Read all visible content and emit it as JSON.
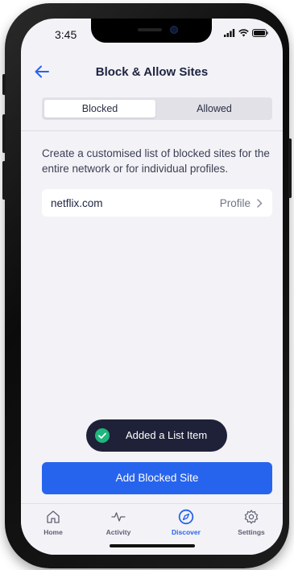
{
  "status_bar": {
    "time": "3:45"
  },
  "header": {
    "title": "Block & Allow Sites"
  },
  "segmented": {
    "blocked": "Blocked",
    "allowed": "Allowed"
  },
  "main": {
    "description": "Create a customised list of blocked sites for the entire network or for individual profiles.",
    "list": [
      {
        "site": "netflix.com",
        "scope": "Profile"
      }
    ]
  },
  "toast": {
    "text": "Added a List Item"
  },
  "primary_button": {
    "label": "Add Blocked Site"
  },
  "tabbar": {
    "items": [
      {
        "label": "Home",
        "icon": "home-icon"
      },
      {
        "label": "Activity",
        "icon": "activity-icon"
      },
      {
        "label": "Discover",
        "icon": "compass-icon",
        "active": true
      },
      {
        "label": "Settings",
        "icon": "gear-icon"
      }
    ]
  },
  "colors": {
    "accent": "#2764ee",
    "toast_bg": "#1e2138",
    "success": "#1fb57d",
    "title": "#1d2340"
  }
}
